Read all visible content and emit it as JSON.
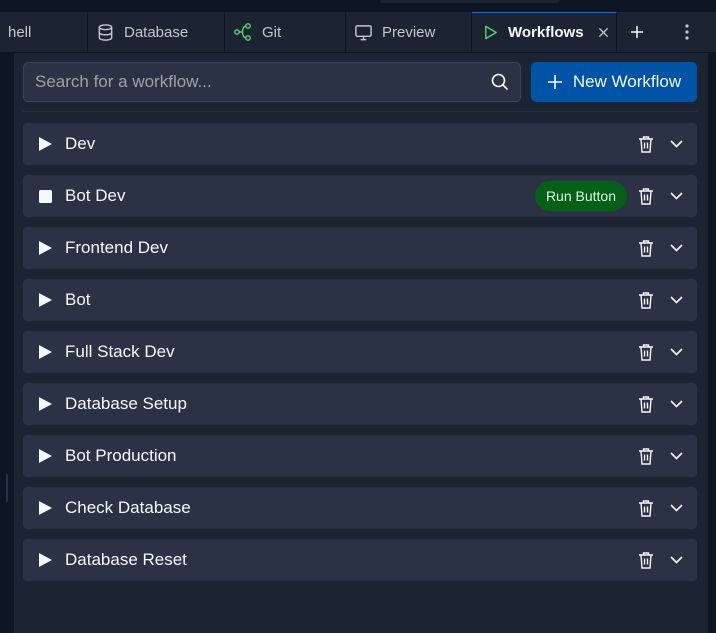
{
  "tabs": [
    {
      "label": "hell",
      "icon": "shell-icon",
      "active": false
    },
    {
      "label": "Database",
      "icon": "database-icon",
      "active": false
    },
    {
      "label": "Git",
      "icon": "git-icon",
      "active": false
    },
    {
      "label": "Preview",
      "icon": "monitor-icon",
      "active": false
    },
    {
      "label": "Workflows",
      "icon": "play-icon",
      "active": true
    }
  ],
  "tabbar": {
    "add_tab_icon": "plus-icon",
    "menu_icon": "kebab-icon"
  },
  "search": {
    "placeholder": "Search for a workflow...",
    "value": ""
  },
  "new_workflow": {
    "label": "New Workflow"
  },
  "workflows": [
    {
      "name": "Dev",
      "state": "stopped"
    },
    {
      "name": "Bot Dev",
      "state": "running",
      "badge": "Run Button"
    },
    {
      "name": "Frontend Dev",
      "state": "stopped"
    },
    {
      "name": "Bot",
      "state": "stopped"
    },
    {
      "name": "Full Stack Dev",
      "state": "stopped"
    },
    {
      "name": "Database Setup",
      "state": "stopped"
    },
    {
      "name": "Bot Production",
      "state": "stopped"
    },
    {
      "name": "Check Database",
      "state": "stopped"
    },
    {
      "name": "Database Reset",
      "state": "stopped"
    }
  ],
  "colors": {
    "accent": "#0053a6",
    "run_badge": "#036016",
    "workflows_tab_icon": "#58d16b"
  }
}
